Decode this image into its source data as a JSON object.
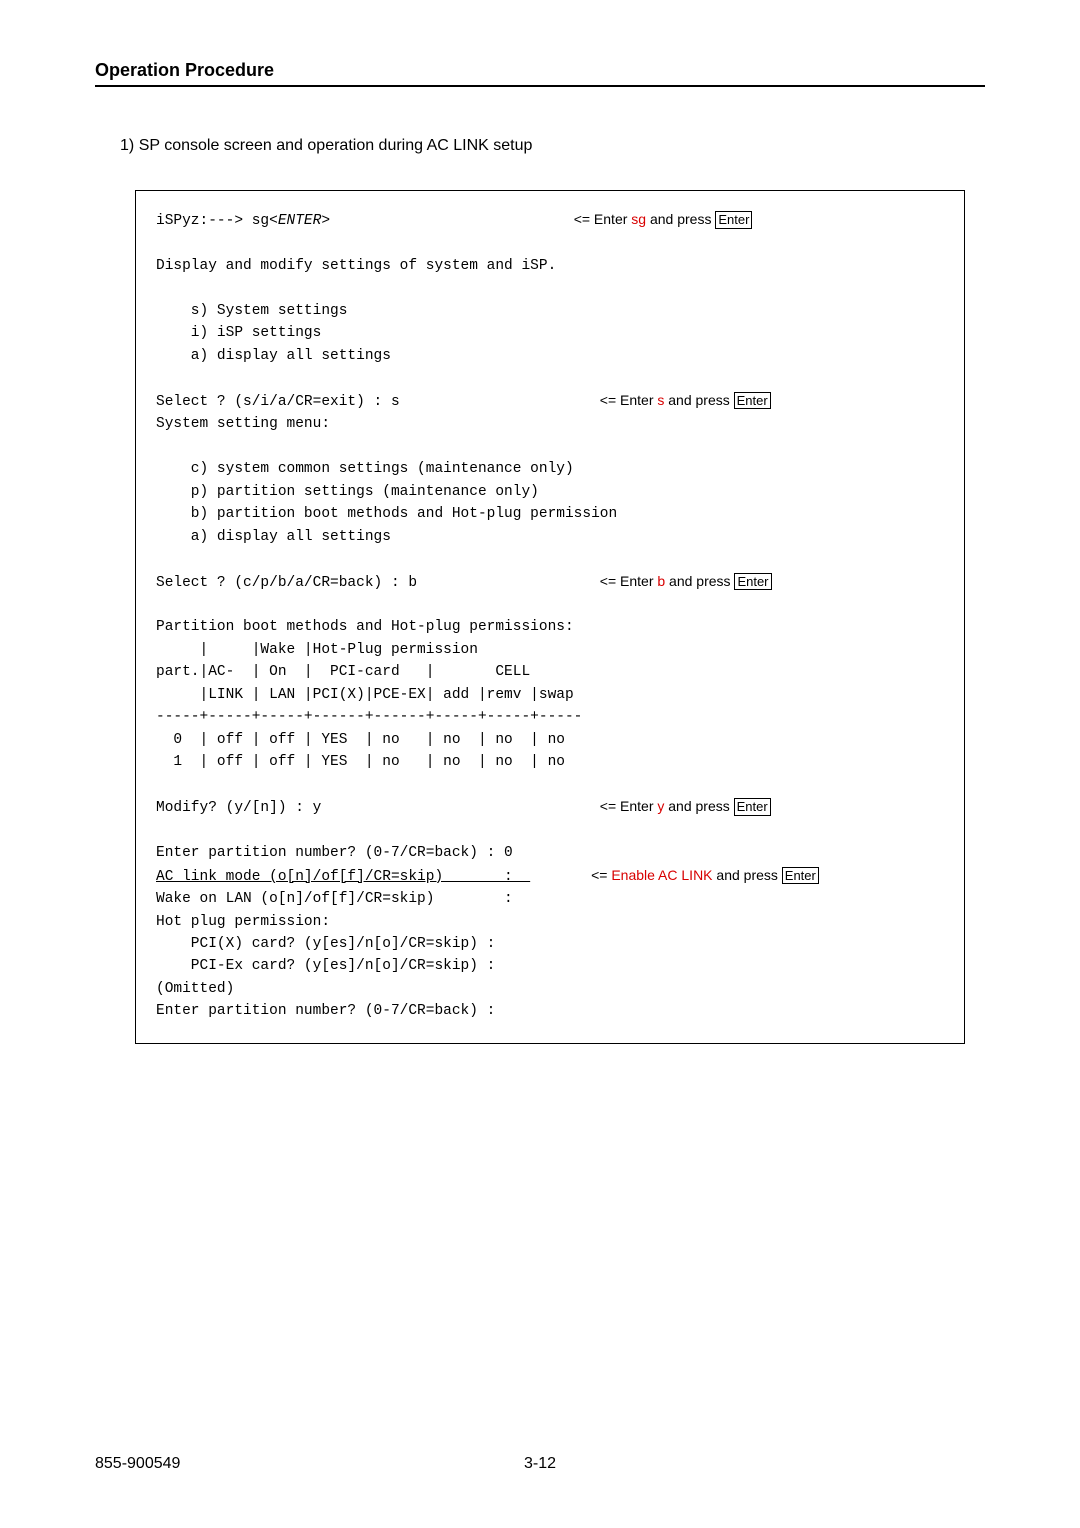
{
  "header": {
    "title": "Operation Procedure"
  },
  "intro": {
    "number": "1)",
    "text": "SP console screen and operation during AC LINK setup"
  },
  "lines": {
    "l01a": "iSPyz:---> sg",
    "l01b": "<ENTER>",
    "l01_annot_pre": "<= Enter ",
    "l01_annot_key": "sg",
    "l01_annot_post": " and press ",
    "l01_enter": "Enter",
    "l02": "Display and modify settings of system and iSP.",
    "l03": "    s) System settings",
    "l04": "    i) iSP settings",
    "l05": "    a) display all settings",
    "l06a": "Select ? (s/i/a/CR=exit) : s",
    "l06_annot_pre": "<= Enter ",
    "l06_annot_key": "s",
    "l06_annot_post": " and press ",
    "l07": "System setting menu:",
    "l08": "    c) system common settings (maintenance only)",
    "l09": "    p) partition settings (maintenance only)",
    "l10": "    b) partition boot methods and Hot-plug permission",
    "l11": "    a) display all settings",
    "l12a": "Select ? (c/p/b/a/CR=back) : b",
    "l12_annot_pre": "<= Enter ",
    "l12_annot_key": "b",
    "l12_annot_post": " and press ",
    "l13": "Partition boot methods and Hot-plug permissions:",
    "l14": "     |     |Wake |Hot-Plug permission",
    "l15": "part.|AC-  | On  |  PCI-card   |       CELL",
    "l16": "     |LINK | LAN |PCI(X)|PCE-EX| add |remv |swap",
    "l17": "-----+-----+-----+------+------+-----+-----+-----",
    "l18": "  0  | off | off | YES  | no   | no  | no  | no",
    "l19": "  1  | off | off | YES  | no   | no  | no  | no",
    "l20a": "Modify? (y/[n]) : y",
    "l20_annot_pre": "<= Enter ",
    "l20_annot_key": "y",
    "l20_annot_post": " and press ",
    "l21": "Enter partition number? (0-7/CR=back) : 0",
    "l22a": "AC link mode (o[n]/of[f]/CR=skip)       :  ",
    "l22_annot_pre": "<= ",
    "l22_annot_key": "Enable AC LINK",
    "l22_annot_post": " and press ",
    "l23": "Wake on LAN (o[n]/of[f]/CR=skip)        :",
    "l24": "Hot plug permission:",
    "l25": "    PCI(X) card? (y[es]/n[o]/CR=skip) :",
    "l26": "    PCI-Ex card? (y[es]/n[o]/CR=skip) :",
    "l27": "(Omitted)",
    "l28": "Enter partition number? (0-7/CR=back) :"
  },
  "footer": {
    "docnum": "855-900549",
    "pagenum": "3-12"
  }
}
